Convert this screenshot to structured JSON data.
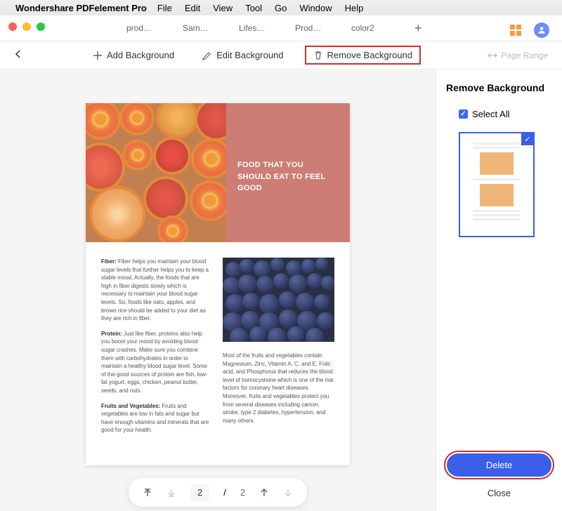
{
  "menubar": {
    "app_name": "Wondershare PDFelement Pro",
    "items": [
      "File",
      "Edit",
      "View",
      "Tool",
      "Go",
      "Window",
      "Help"
    ]
  },
  "tabs": [
    "prod…",
    "Sam…",
    "Lifes…",
    "Prod…",
    "color2"
  ],
  "toolbar": {
    "add_bg": "Add Background",
    "edit_bg": "Edit Background",
    "remove_bg": "Remove Background",
    "page_range": "Page Range"
  },
  "document": {
    "hero": "FOOD THAT YOU SHOULD EAT TO FEEL GOOD",
    "fiber_label": "Fiber:",
    "fiber_text": " Fiber helps you maintain your blood sugar levels that further helps you to keep a stable mood. Actually, the foods that are high in fiber digests slowly which is necessary to maintain your blood sugar levels. So, foods like oats, apples, and brown rice should be added to your diet as they are rich in fiber.",
    "protein_label": "Protein:",
    "protein_text": " Just like fiber, proteins also help you boost your mood by avoiding blood sugar crashes. Make sure you combine them with carbohydrates in order to maintain a healthy blood sugar level. Some of the good sources of protein are fish, low-fat yogurt, eggs, chicken, peanut butter, seeds, and nuts.",
    "fv_label": "Fruits and Vegetables:",
    "fv_text": " Fruits and vegetables are low in fats and sugar but have enough vitamins and minerals that are good for your health.",
    "right_text": "Most of the fruits and vegetables contain Magnesium, Zinc, Vitamin A, C, and E, Folic acid, and Phosphorus that reduces the blood level of homocysteine which is one of the risk factors for coronary heart diseases. Moreover, fruits and vegetables protect you from several diseases including cancer, stroke, type 2 diabetes, hypertension, and many others."
  },
  "page_controls": {
    "current": "2",
    "total": "2"
  },
  "side_panel": {
    "title": "Remove Background",
    "select_all": "Select All",
    "delete": "Delete",
    "close": "Close"
  }
}
